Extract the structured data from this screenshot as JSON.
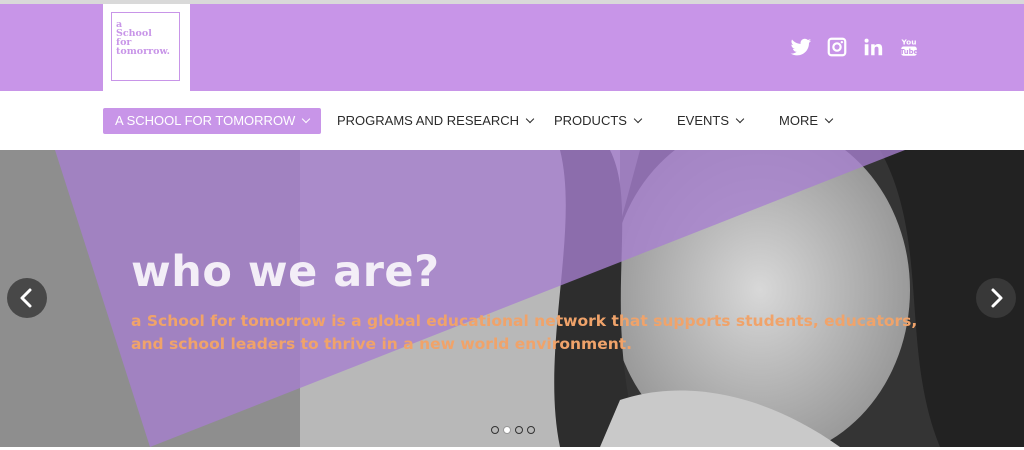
{
  "logo": {
    "lines": [
      "a",
      "School",
      "for",
      "tomorrow."
    ]
  },
  "socials": [
    {
      "icon": "twitter-icon"
    },
    {
      "icon": "instagram-icon"
    },
    {
      "icon": "linkedin-icon"
    },
    {
      "icon": "youtube-icon"
    }
  ],
  "nav": {
    "items": [
      {
        "label": "A SCHOOL FOR TOMORROW",
        "active": true
      },
      {
        "label": "PROGRAMS AND RESEARCH",
        "active": false
      },
      {
        "label": "PRODUCTS",
        "active": false
      },
      {
        "label": "EVENTS",
        "active": false
      },
      {
        "label": "MORE",
        "active": false
      }
    ]
  },
  "hero": {
    "title": "who we are?",
    "subtitle": "a School for tomorrow is a global educational network that supports students, educators, and school leaders to thrive in a new world environment.",
    "slides": 4,
    "active_slide": 2
  },
  "colors": {
    "brand": "#c895e8",
    "accent_text": "#f0a36a",
    "overlay": "#a77fd0"
  }
}
